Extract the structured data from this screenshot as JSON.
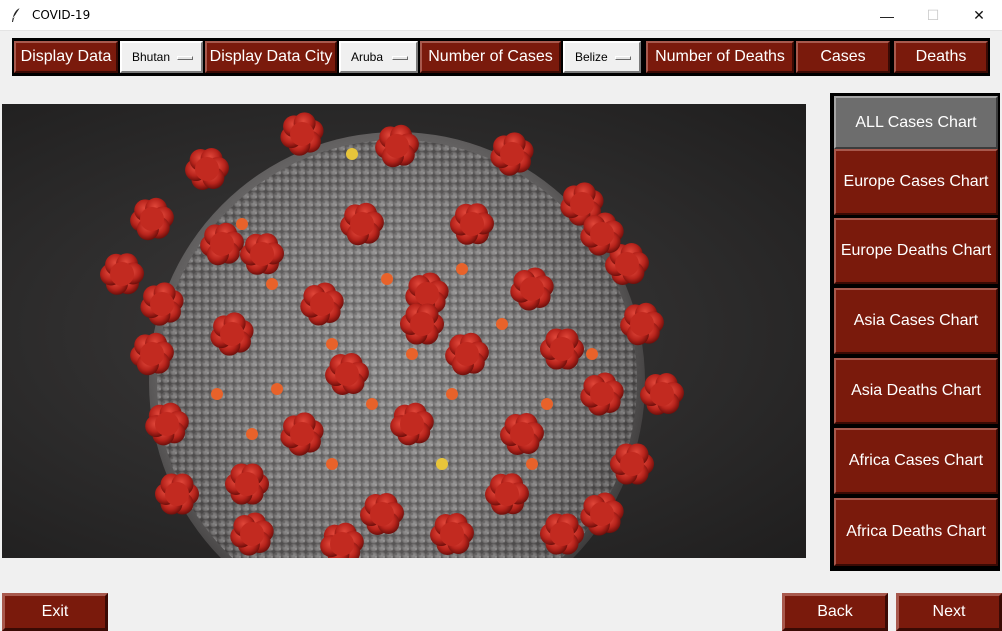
{
  "window": {
    "title": "COVID-19",
    "minimize_glyph": "—",
    "maximize_glyph": "☐",
    "close_glyph": "✕",
    "icon": "feather-icon"
  },
  "toolbar": {
    "display_data_label": "Display Data",
    "display_data_value": "Bhutan",
    "display_data_city_label": "Display Data City",
    "display_data_city_value": "Aruba",
    "number_of_cases_label": "Number of Cases",
    "number_of_cases_value": "Belize",
    "number_of_deaths_label": "Number of Deaths",
    "cases_label": "Cases",
    "deaths_label": "Deaths"
  },
  "main_image": {
    "description_icon": "coronavirus-image"
  },
  "sidebar": {
    "items": [
      {
        "label": "ALL Cases Chart",
        "active": true
      },
      {
        "label": "Europe Cases Chart",
        "active": false
      },
      {
        "label": "Europe Deaths Chart",
        "active": false
      },
      {
        "label": "Asia Cases Chart",
        "active": false
      },
      {
        "label": "Asia Deaths Chart",
        "active": false
      },
      {
        "label": "Africa Cases Chart",
        "active": false
      },
      {
        "label": "Africa Deaths Chart",
        "active": false
      }
    ]
  },
  "footer": {
    "exit_label": "Exit",
    "back_label": "Back",
    "next_label": "Next"
  },
  "colors": {
    "button_bg": "#7a1a0c",
    "button_active_bg": "#6d6d6d",
    "frame": "#000000",
    "window_bg": "#f0f0f0"
  }
}
